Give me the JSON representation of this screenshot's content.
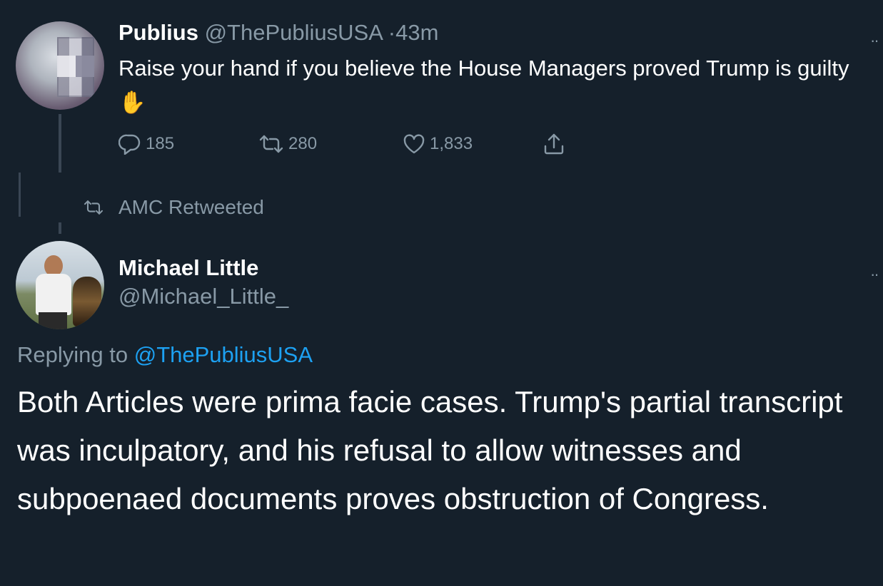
{
  "tweet1": {
    "name": "Publius",
    "handle": "@ThePubliusUSA",
    "separator": "·",
    "time": "43m",
    "text": "Raise your hand if you believe the House Managers proved Trump is guilty",
    "emoji": "✋",
    "actions": {
      "replies": "185",
      "retweets": "280",
      "likes": "1,833"
    },
    "more": "··"
  },
  "retweet_banner": {
    "label": "AMC Retweeted"
  },
  "tweet2": {
    "name": "Michael Little",
    "handle": "@Michael_Little_",
    "replying_prefix": "Replying to",
    "replying_handle": "@ThePubliusUSA",
    "text": "Both Articles were prima facie cases. Trump's partial transcript was inculpatory, and his refusal to allow witnesses and subpoenaed documents proves obstruction of Congress.",
    "more": "··"
  },
  "icons": {
    "reply": "reply-icon",
    "retweet": "retweet-icon",
    "like": "heart-icon",
    "share": "share-icon"
  },
  "colors": {
    "background": "#15202b",
    "text": "#ffffff",
    "muted": "#8899a6",
    "link": "#1da1f2"
  }
}
